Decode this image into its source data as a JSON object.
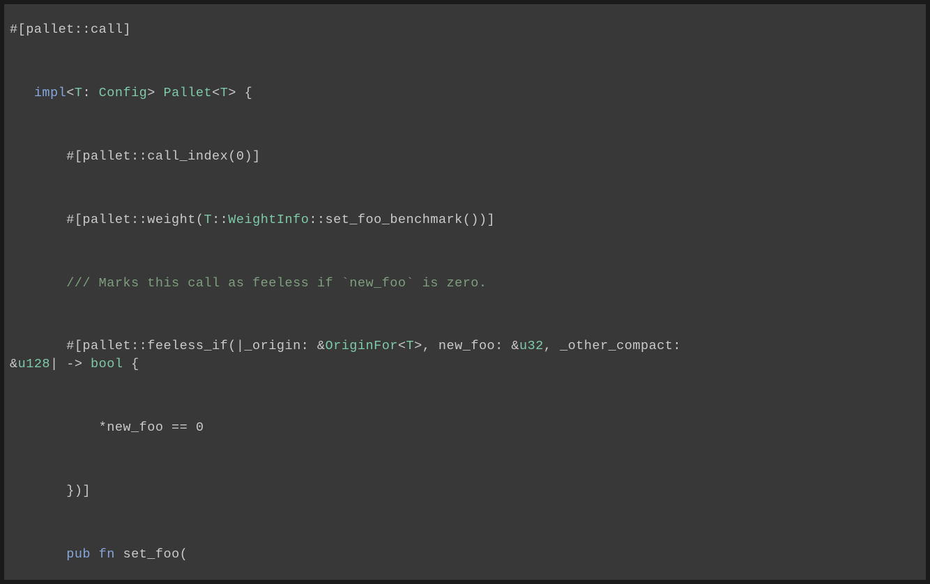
{
  "code": {
    "line1": {
      "full": "#[pallet::call]"
    },
    "line2": {
      "indent": "   ",
      "impl": "impl",
      "lt": "<",
      "t1": "T",
      "colon_config": ": ",
      "config": "Config",
      "gt_space": "> ",
      "pallet": "Pallet",
      "lt2": "<",
      "t2": "T",
      "gt_brace": "> {"
    },
    "line3": {
      "indent": "       ",
      "text": "#[pallet::call_index(0)]"
    },
    "line4": {
      "indent": "       ",
      "prefix": "#[pallet::weight(",
      "t": "T",
      "cc": "::",
      "weightinfo": "WeightInfo",
      "suffix": "::set_foo_benchmark())]"
    },
    "line5": {
      "indent": "       ",
      "comment": "/// Marks this call as feeless if `new_foo` is zero."
    },
    "line6": {
      "indent": "       ",
      "prefix": "#[pallet::feeless_if(|_origin: &",
      "originfor": "OriginFor",
      "lt": "<",
      "t": "T",
      "gt_comma": ">, new_foo: &",
      "u32": "u32",
      "other": ", _other_compact: "
    },
    "line6b": {
      "amp": "&",
      "u128": "u128",
      "pipe_arrow": "| -> ",
      "bool": "bool",
      "brace": " {"
    },
    "line7": {
      "indent": "           ",
      "text": "*new_foo == 0"
    },
    "line8": {
      "indent": "       ",
      "text": "})]"
    },
    "line9": {
      "indent": "       ",
      "pub": "pub",
      "space1": " ",
      "fn": "fn",
      "space2": " ",
      "name": "set_foo("
    }
  }
}
